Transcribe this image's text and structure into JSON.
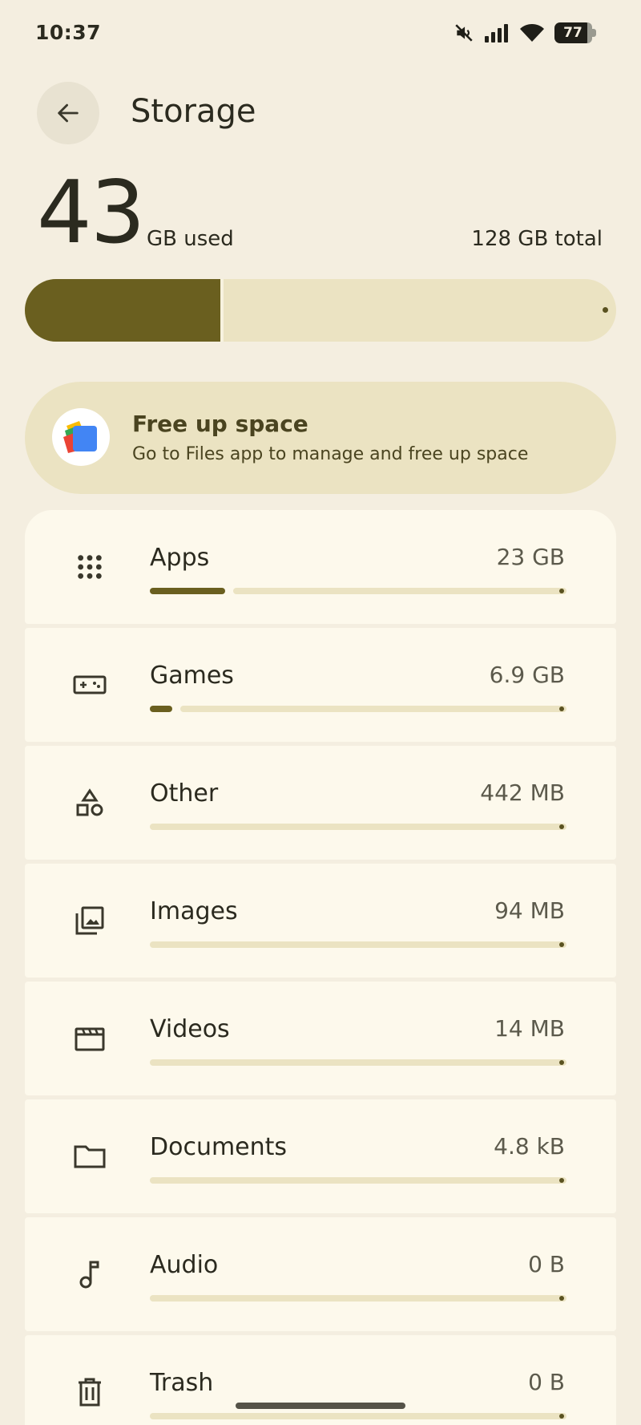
{
  "status_bar": {
    "time": "10:37",
    "battery": "77",
    "icons": [
      "mute-icon",
      "signal-icon",
      "wifi-icon",
      "battery-icon"
    ]
  },
  "header": {
    "title": "Storage"
  },
  "summary": {
    "used_value": "43",
    "used_unit": "GB used",
    "total": "128 GB total",
    "used_fraction": 0.336
  },
  "free_up": {
    "title": "Free up space",
    "subtitle": "Go to Files app to manage and free up space"
  },
  "categories": [
    {
      "name": "Apps",
      "size": "23 GB",
      "fraction": 0.18,
      "icon": "apps-grid-icon"
    },
    {
      "name": "Games",
      "size": "6.9 GB",
      "fraction": 0.054,
      "icon": "gamepad-icon"
    },
    {
      "name": "Other",
      "size": "442 MB",
      "fraction": 0.0,
      "icon": "shapes-icon"
    },
    {
      "name": "Images",
      "size": "94 MB",
      "fraction": 0.0,
      "icon": "images-icon"
    },
    {
      "name": "Videos",
      "size": "14 MB",
      "fraction": 0.0,
      "icon": "clapperboard-icon"
    },
    {
      "name": "Documents",
      "size": "4.8 kB",
      "fraction": 0.0,
      "icon": "folder-icon"
    },
    {
      "name": "Audio",
      "size": "0 B",
      "fraction": 0.0,
      "icon": "music-note-icon"
    },
    {
      "name": "Trash",
      "size": "0 B",
      "fraction": 0.0,
      "icon": "trash-icon"
    }
  ],
  "colors": {
    "background": "#f4eee0",
    "accent": "#6a5f1f",
    "track": "#ebe3c2",
    "card": "#fdf9ec"
  }
}
